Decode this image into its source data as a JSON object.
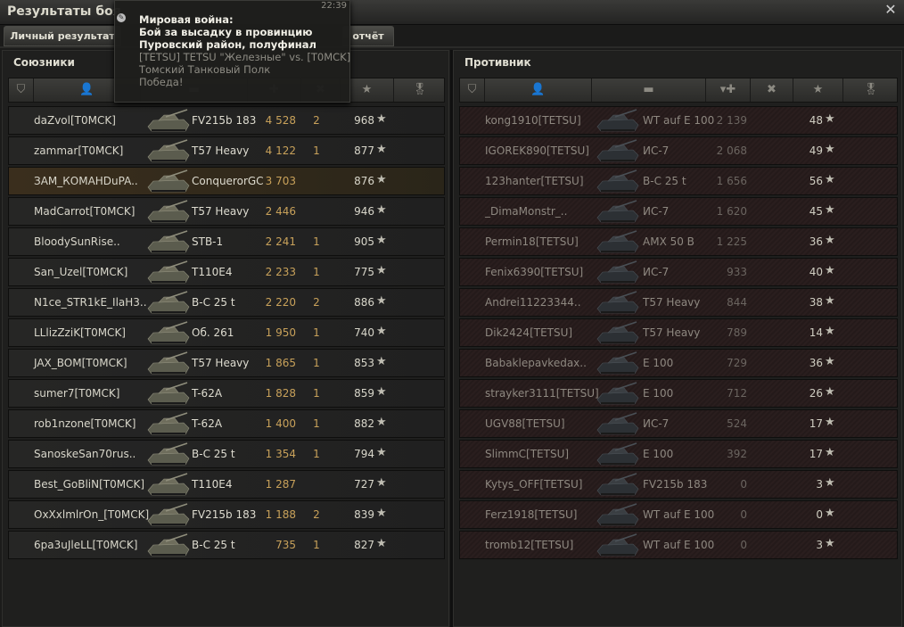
{
  "window": {
    "title": "Результаты боя",
    "close_glyph": "✕"
  },
  "tabs": [
    {
      "label": "Личный результат"
    },
    {
      "label": "отчёт"
    }
  ],
  "tooltip": {
    "time": "22:39",
    "line1": "Мировая война:",
    "line2": "Бой за высадку в провинцию",
    "line3": "Пуровский район, полуфинал",
    "line4": "[TETSU] TETSU \"Железные\" vs. [T0MCK]",
    "line5": "Томский Танковый Полк",
    "line6": "Победа!"
  },
  "allies": {
    "title": "Союзники",
    "rows": [
      {
        "player": "daZvol[T0MCK]",
        "tank": "FV215b 183",
        "damage": "4 528",
        "kills": "2",
        "xp": "968"
      },
      {
        "player": "zammar[T0MCK]",
        "tank": "T57 Heavy",
        "damage": "4 122",
        "kills": "1",
        "xp": "877"
      },
      {
        "player": "ЗАМ_КОМАНDuPA..",
        "tank": "ConquerorGC",
        "damage": "3 703",
        "kills": "",
        "xp": "876",
        "self": true
      },
      {
        "player": "MadCarrot[T0MCK]",
        "tank": "T57 Heavy",
        "damage": "2 446",
        "kills": "",
        "xp": "946"
      },
      {
        "player": "BloodySunRise..",
        "tank": "STB-1",
        "damage": "2 241",
        "kills": "1",
        "xp": "905"
      },
      {
        "player": "San_Uzel[T0MCK]",
        "tank": "T110E4",
        "damage": "2 233",
        "kills": "1",
        "xp": "775"
      },
      {
        "player": "N1ce_STR1kE_IlaH3..",
        "tank": "B-C 25 t",
        "damage": "2 220",
        "kills": "2",
        "xp": "886"
      },
      {
        "player": "LLlizZziK[T0MCK]",
        "tank": "Об. 261",
        "damage": "1 950",
        "kills": "1",
        "xp": "740"
      },
      {
        "player": "JAX_BOM[T0MCK]",
        "tank": "T57 Heavy",
        "damage": "1 865",
        "kills": "1",
        "xp": "853"
      },
      {
        "player": "sumer7[T0MCK]",
        "tank": "T-62A",
        "damage": "1 828",
        "kills": "1",
        "xp": "859"
      },
      {
        "player": "rob1nzone[T0MCK]",
        "tank": "T-62A",
        "damage": "1 400",
        "kills": "1",
        "xp": "882"
      },
      {
        "player": "SanoskeSan70rus..",
        "tank": "B-C 25 t",
        "damage": "1 354",
        "kills": "1",
        "xp": "794"
      },
      {
        "player": "Best_GoBliN[T0MCK]",
        "tank": "T110E4",
        "damage": "1 287",
        "kills": "",
        "xp": "727"
      },
      {
        "player": "OxXxlmlrOn_[T0MCK]",
        "tank": "FV215b 183",
        "damage": "1 188",
        "kills": "2",
        "xp": "839"
      },
      {
        "player": "6pa3uJleLL[T0MCK]",
        "tank": "B-C 25 t",
        "damage": "735",
        "kills": "1",
        "xp": "827"
      }
    ]
  },
  "enemies": {
    "title": "Противник",
    "rows": [
      {
        "player": "kong1910[TETSU]",
        "tank": "WT auf E 100",
        "damage": "2 139",
        "xp": "48"
      },
      {
        "player": "IGOREK890[TETSU]",
        "tank": "ИС-7",
        "damage": "2 068",
        "xp": "49"
      },
      {
        "player": "123hanter[TETSU]",
        "tank": "B-C 25 t",
        "damage": "1 656",
        "xp": "56"
      },
      {
        "player": "_DimaMonstr_..",
        "tank": "ИС-7",
        "damage": "1 620",
        "xp": "45"
      },
      {
        "player": "Permin18[TETSU]",
        "tank": "AMX 50 B",
        "damage": "1 225",
        "xp": "36"
      },
      {
        "player": "Fenix6390[TETSU]",
        "tank": "ИС-7",
        "damage": "933",
        "xp": "40"
      },
      {
        "player": "Andrei11223344..",
        "tank": "T57 Heavy",
        "damage": "844",
        "xp": "38"
      },
      {
        "player": "Dik2424[TETSU]",
        "tank": "T57 Heavy",
        "damage": "789",
        "xp": "14"
      },
      {
        "player": "Babaklepavkedax..",
        "tank": "E 100",
        "damage": "729",
        "xp": "36"
      },
      {
        "player": "strayker3111[TETSU]",
        "tank": "E 100",
        "damage": "712",
        "xp": "26"
      },
      {
        "player": "UGV88[TETSU]",
        "tank": "ИС-7",
        "damage": "524",
        "xp": "17"
      },
      {
        "player": "SlimmC[TETSU]",
        "tank": "E 100",
        "damage": "392",
        "xp": "17"
      },
      {
        "player": "Kytys_OFF[TETSU]",
        "tank": "FV215b 183",
        "damage": "0",
        "xp": "3"
      },
      {
        "player": "Ferz1918[TETSU]",
        "tank": "WT auf E 100",
        "damage": "0",
        "xp": "0"
      },
      {
        "player": "tromb12[TETSU]",
        "tank": "WT auf E 100",
        "damage": "0",
        "xp": "3"
      }
    ]
  },
  "icons": {
    "star": "★",
    "sort": "▾"
  },
  "colors": {
    "damage": "#c8a15a",
    "self_row": "#3a2e1d",
    "enemy_row": "#2a1e1e"
  }
}
